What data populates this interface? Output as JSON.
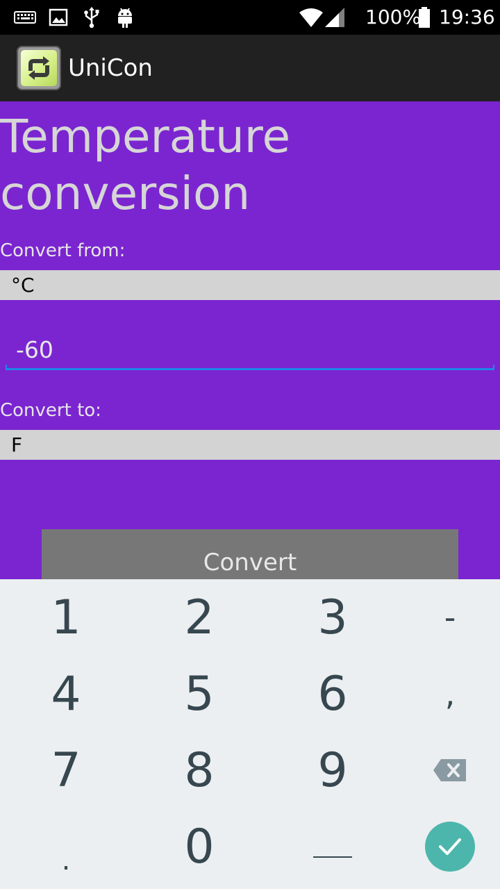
{
  "status_bar": {
    "battery_percent": "100%",
    "time": "19:36",
    "icons": [
      "keyboard-icon",
      "image-icon",
      "usb-icon",
      "android-icon",
      "wifi-icon",
      "signal-icon",
      "battery-icon"
    ]
  },
  "app_bar": {
    "title": "UniCon",
    "icon": "convert-arrows-icon"
  },
  "main": {
    "title_line1": "Temperature",
    "title_line2": "conversion",
    "from_label": "Convert from:",
    "from_unit": "°C",
    "value": "-60",
    "to_label": "Convert to:",
    "to_unit": "F",
    "convert_button": "Convert"
  },
  "keyboard": {
    "keys": {
      "k1": "1",
      "k2": "2",
      "k3": "3",
      "kminus": "-",
      "k4": "4",
      "k5": "5",
      "k6": "6",
      "kcomma": ",",
      "k7": "7",
      "k8": "8",
      "k9": "9",
      "kdot": ".",
      "k0": "0"
    },
    "accent_color": "#4db6ac"
  },
  "colors": {
    "background": "#7b25d1",
    "spinner": "#d3d3d3",
    "button": "#777777",
    "field_underline": "#1e88e5"
  }
}
